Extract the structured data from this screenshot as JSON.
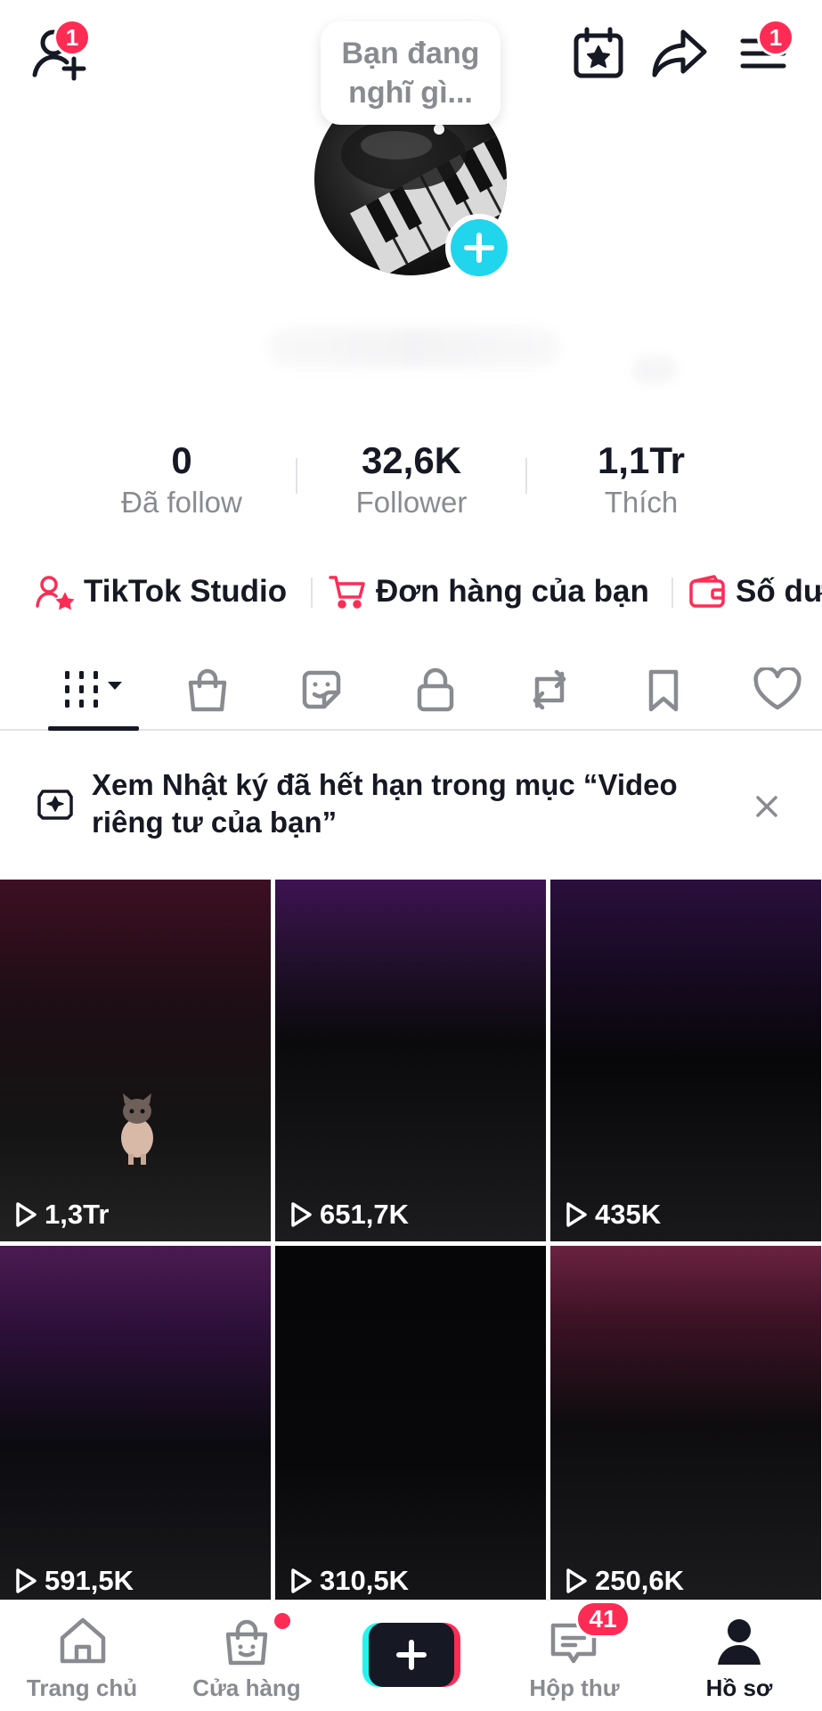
{
  "header": {
    "add_friend_badge": "1",
    "menu_badge": "1",
    "thought_prompt_line1": "Bạn đang",
    "thought_prompt_line2": "nghĩ gì..."
  },
  "stats": [
    {
      "value": "0",
      "label": "Đã follow"
    },
    {
      "value": "32,6K",
      "label": "Follower"
    },
    {
      "value": "1,1Tr",
      "label": "Thích"
    }
  ],
  "quick_links": [
    {
      "label": "TikTok Studio",
      "icon": "person-star-icon"
    },
    {
      "label": "Đơn hàng của bạn",
      "icon": "cart-icon"
    },
    {
      "label": "Số dư",
      "icon": "wallet-icon"
    }
  ],
  "tabs": [
    {
      "name": "videos",
      "icon": "grid-icon"
    },
    {
      "name": "shop",
      "icon": "shopping-bag-icon"
    },
    {
      "name": "stickers",
      "icon": "sticker-icon"
    },
    {
      "name": "private",
      "icon": "lock-icon"
    },
    {
      "name": "reposts",
      "icon": "repost-icon"
    },
    {
      "name": "favorites",
      "icon": "bookmark-icon"
    },
    {
      "name": "liked",
      "icon": "heart-icon"
    }
  ],
  "notice": {
    "text": "Xem Nhật ký đã hết hạn trong mục “Video riêng tư của bạn”"
  },
  "videos": [
    {
      "views": "1,3Tr"
    },
    {
      "views": "651,7K"
    },
    {
      "views": "435K"
    },
    {
      "views": "591,5K"
    },
    {
      "views": "310,5K"
    },
    {
      "views": "250,6K"
    }
  ],
  "bottom_nav": {
    "home": "Trang chủ",
    "shop": "Cửa hàng",
    "inbox": "Hộp thư",
    "inbox_badge": "41",
    "profile": "Hồ sơ"
  },
  "colors": {
    "accent": "#fe2c55",
    "cyan": "#25f4ee",
    "text_primary": "#161823",
    "text_secondary": "#8a8b91"
  }
}
